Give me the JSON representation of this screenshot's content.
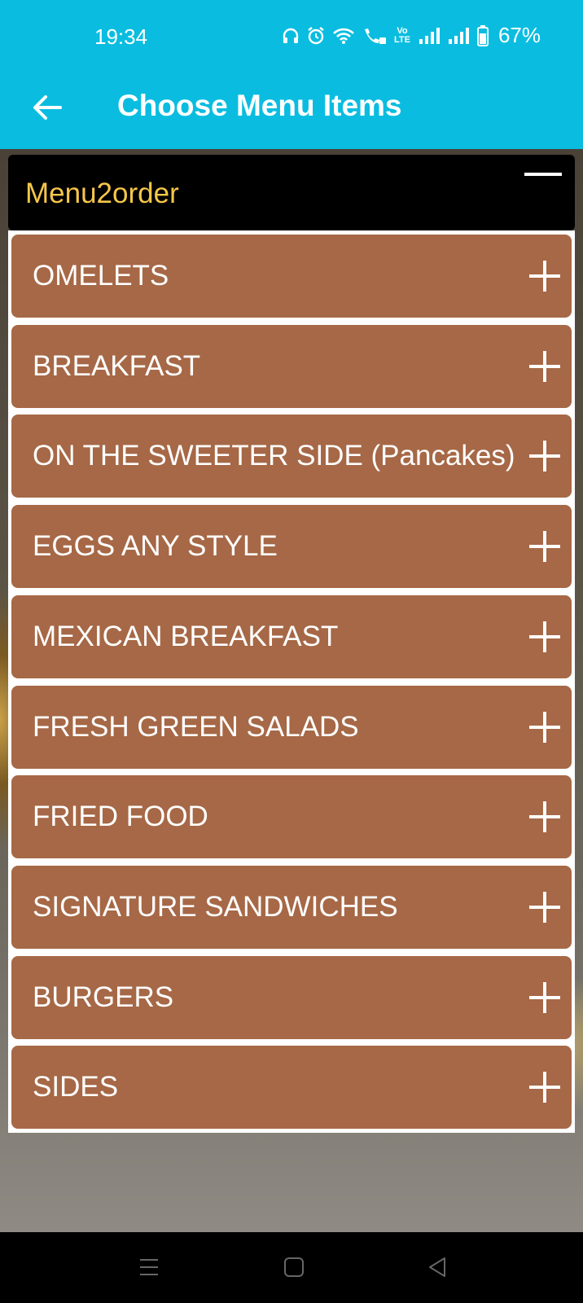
{
  "status_bar": {
    "time": "19:34",
    "icons": [
      "headphones-icon",
      "alarm-icon",
      "wifi-icon",
      "wifi-calling-icon",
      "volte-icon",
      "signal-icon",
      "signal-icon",
      "battery-icon"
    ],
    "volte_label": "Vo LTE",
    "battery": "67%"
  },
  "app_bar": {
    "title": "Choose Menu Items",
    "back_icon": "arrow-left-icon"
  },
  "panel": {
    "title": "Menu2order",
    "collapse_icon": "minus-icon"
  },
  "categories": [
    {
      "label": "OMELETS"
    },
    {
      "label": "BREAKFAST"
    },
    {
      "label": "ON THE SWEETER SIDE (Pancakes)"
    },
    {
      "label": "EGGS ANY STYLE"
    },
    {
      "label": "MEXICAN BREAKFAST"
    },
    {
      "label": "FRESH GREEN SALADS"
    },
    {
      "label": "FRIED FOOD"
    },
    {
      "label": "SIGNATURE SANDWICHES"
    },
    {
      "label": "BURGERS"
    },
    {
      "label": "SIDES"
    }
  ],
  "colors": {
    "app_bar": "#0abde0",
    "panel_header": "#000000",
    "panel_title": "#f6c64a",
    "category_bg": "#a66846",
    "category_text": "#ffffff"
  },
  "nav_bar": {
    "buttons": [
      "menu-icon",
      "home-icon",
      "back-triangle-icon"
    ]
  }
}
